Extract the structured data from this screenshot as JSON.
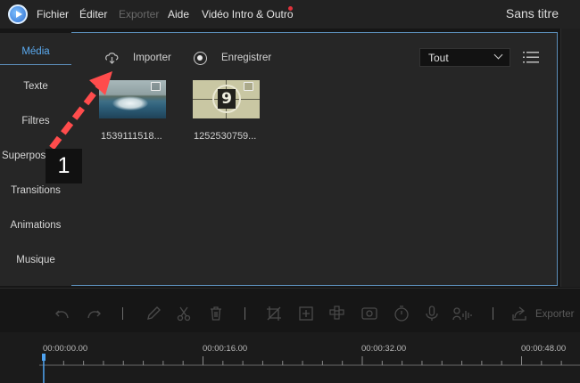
{
  "menu": {
    "file": "Fichier",
    "edit": "Éditer",
    "export": "Exporter",
    "help": "Aide",
    "intro": "Vidéo Intro & Outro"
  },
  "project_title": "Sans titre",
  "sidebar": {
    "tabs": [
      {
        "label": "Média",
        "active": true
      },
      {
        "label": "Texte"
      },
      {
        "label": "Filtres"
      },
      {
        "label": "Superposition"
      },
      {
        "label": "Transitions"
      },
      {
        "label": "Animations"
      },
      {
        "label": "Musique"
      }
    ]
  },
  "media": {
    "import_label": "Importer",
    "record_label": "Enregistrer",
    "filter_value": "Tout",
    "items": [
      {
        "label": "1539111518..."
      },
      {
        "label": "1252530759...",
        "number": "9"
      }
    ]
  },
  "annotation": {
    "step": "1"
  },
  "timeline": {
    "export_label": "Exporter",
    "times": [
      "00:00:00.00",
      "00:00:16.00",
      "00:00:32.00",
      "00:00:48.00"
    ]
  },
  "colors": {
    "accent": "#5aaaf0",
    "panel_border": "#5b8db8",
    "arrow": "#ff4c4c",
    "record_dot": "#e0323b"
  },
  "icons": [
    "app-logo",
    "import-icon",
    "record-icon",
    "chevron-down-icon",
    "list-view-icon",
    "undo-icon",
    "redo-icon",
    "pen-icon",
    "scissors-icon",
    "trash-icon",
    "crop-icon",
    "zoom-icon",
    "mosaic-icon",
    "freeze-frame-icon",
    "speed-icon",
    "microphone-icon",
    "voice-icon",
    "export-icon"
  ]
}
